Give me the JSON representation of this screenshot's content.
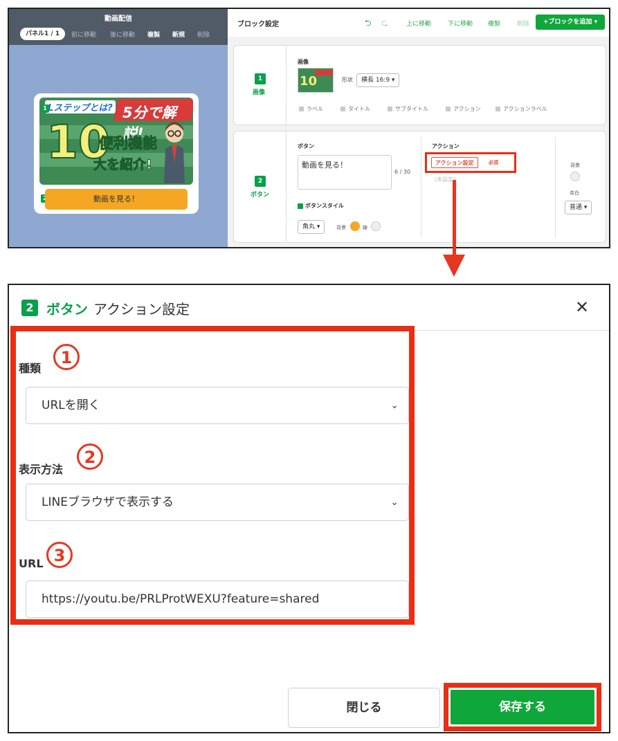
{
  "editor": {
    "app_title": "動画配信",
    "panel_pill": "パネル1 / 1",
    "head_links": [
      "前に移動",
      "後に移動",
      "複製",
      "新規",
      "削除"
    ],
    "preview": {
      "banner_tag": "Lステップとは?",
      "banner_ribbon": "5分で解説!",
      "banner_big": "10",
      "banner_line1": "便利機能",
      "banner_line2": "大を紹介!",
      "badge1": "1",
      "badge2": "2",
      "button_label": "動画を見る！"
    },
    "right": {
      "title": "ブロック設定",
      "undo_icon": "undo-icon",
      "redo_icon": "redo-icon",
      "move_up": "上に移動",
      "move_down": "下に移動",
      "duplicate": "複製",
      "delete": "削除",
      "add_block": "+ブロックを追加 ▾"
    },
    "block1": {
      "num": "1",
      "name": "画像",
      "image_label": "画像",
      "shape_label": "形状",
      "shape_value": "横長 16:9 ▾",
      "options": [
        "ラベル",
        "タイトル",
        "サブタイトル",
        "アクション",
        "アクションラベル"
      ]
    },
    "block2": {
      "num": "2",
      "name": "ボタン",
      "button_label": "ボタン",
      "button_text": "動画を見る！",
      "counter": "6 / 30",
      "style_label": "ボタンスタイル",
      "corner_value": "角丸 ▾",
      "bg_label": "背景",
      "line_label": "線",
      "action_label": "アクション",
      "action_button": "アクション設定",
      "required": "必須",
      "unset": "(未設定)",
      "right_bg_label": "背景",
      "margin_label": "余白",
      "margin_value": "普通 ▾"
    }
  },
  "dialog": {
    "num": "2",
    "block_name": "ボタン",
    "title": "アクション設定",
    "close": "✕",
    "fields": {
      "type_label": "種類",
      "type_marker": "1",
      "type_value": "URLを開く",
      "display_label": "表示方法",
      "display_marker": "2",
      "display_value": "LINEブラウザで表示する",
      "url_label": "URL",
      "url_marker": "3",
      "url_value": "https://youtu.be/PRLProtWEXU?feature=shared"
    },
    "close_button": "閉じる",
    "save_button": "保存する"
  },
  "colors": {
    "brand_green": "#09a04a",
    "highlight_red": "#ea2d15",
    "button_orange": "#f5a623",
    "left_panel_blue": "#8fa8d2"
  }
}
